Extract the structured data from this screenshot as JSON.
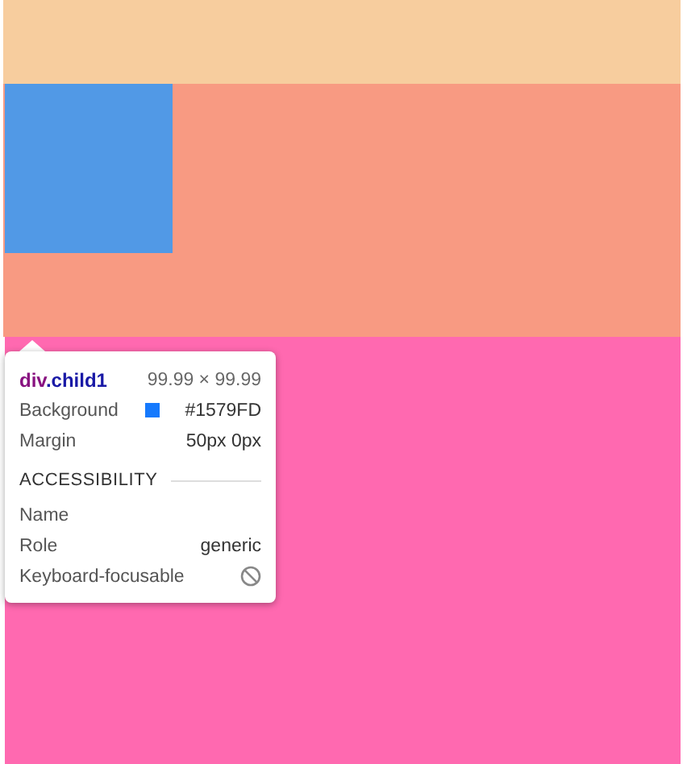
{
  "tooltip": {
    "element_tag": "div",
    "element_class": ".child1",
    "size": "99.99 × 99.99",
    "properties": [
      {
        "label": "Background",
        "value": "#1579FD",
        "color": "#1579fd"
      },
      {
        "label": "Margin",
        "value": "50px 0px"
      }
    ],
    "section_title": "ACCESSIBILITY",
    "accessibility": [
      {
        "label": "Name"
      },
      {
        "label": "Role",
        "value": "generic"
      },
      {
        "label": "Keyboard-focusable",
        "focusable": false
      }
    ]
  }
}
